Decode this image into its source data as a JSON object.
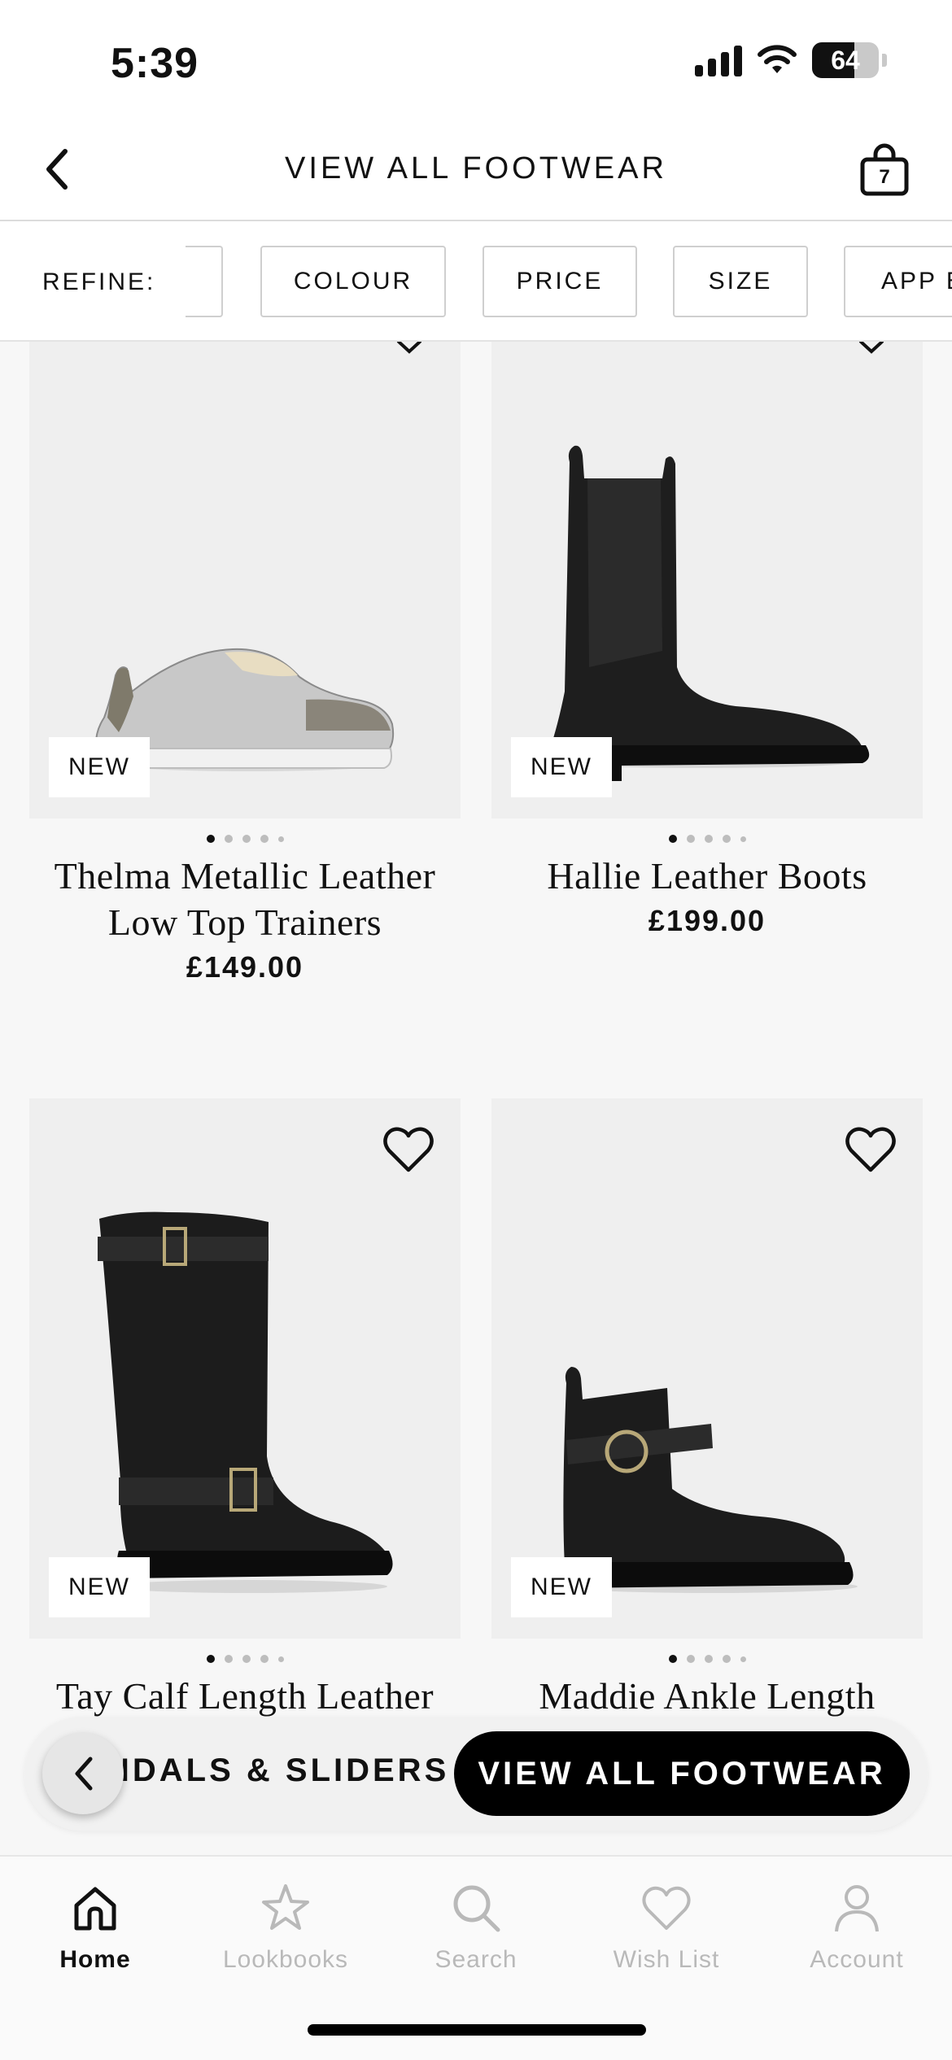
{
  "status_bar": {
    "time": "5:39",
    "battery": "64",
    "battery_level": 0.64
  },
  "header": {
    "title": "VIEW ALL FOOTWEAR",
    "bag_count": "7"
  },
  "refine": {
    "label": "REFINE:",
    "chips": [
      "COLOUR",
      "PRICE",
      "SIZE",
      "APP E"
    ]
  },
  "products": [
    {
      "name_line1": "Thelma Metallic Leather",
      "name_line2": "Low Top Trainers",
      "price": "£149.00",
      "badge": "NEW"
    },
    {
      "name_line1": "Hallie Leather Boots",
      "name_line2": "",
      "price": "£199.00",
      "badge": "NEW"
    },
    {
      "name_line1": "Tay Calf Length Leather",
      "name_line2": "",
      "price": "",
      "badge": "NEW"
    },
    {
      "name_line1": "Maddie Ankle Length",
      "name_line2": "",
      "price": "",
      "badge": "NEW"
    }
  ],
  "category_nav": {
    "previous": "NDALS & SLIDERS",
    "active": "VIEW ALL FOOTWEAR"
  },
  "tabs": [
    {
      "label": "Home",
      "icon": "home-icon"
    },
    {
      "label": "Lookbooks",
      "icon": "star-icon"
    },
    {
      "label": "Search",
      "icon": "search-icon"
    },
    {
      "label": "Wish List",
      "icon": "heart-icon"
    },
    {
      "label": "Account",
      "icon": "person-icon"
    }
  ]
}
